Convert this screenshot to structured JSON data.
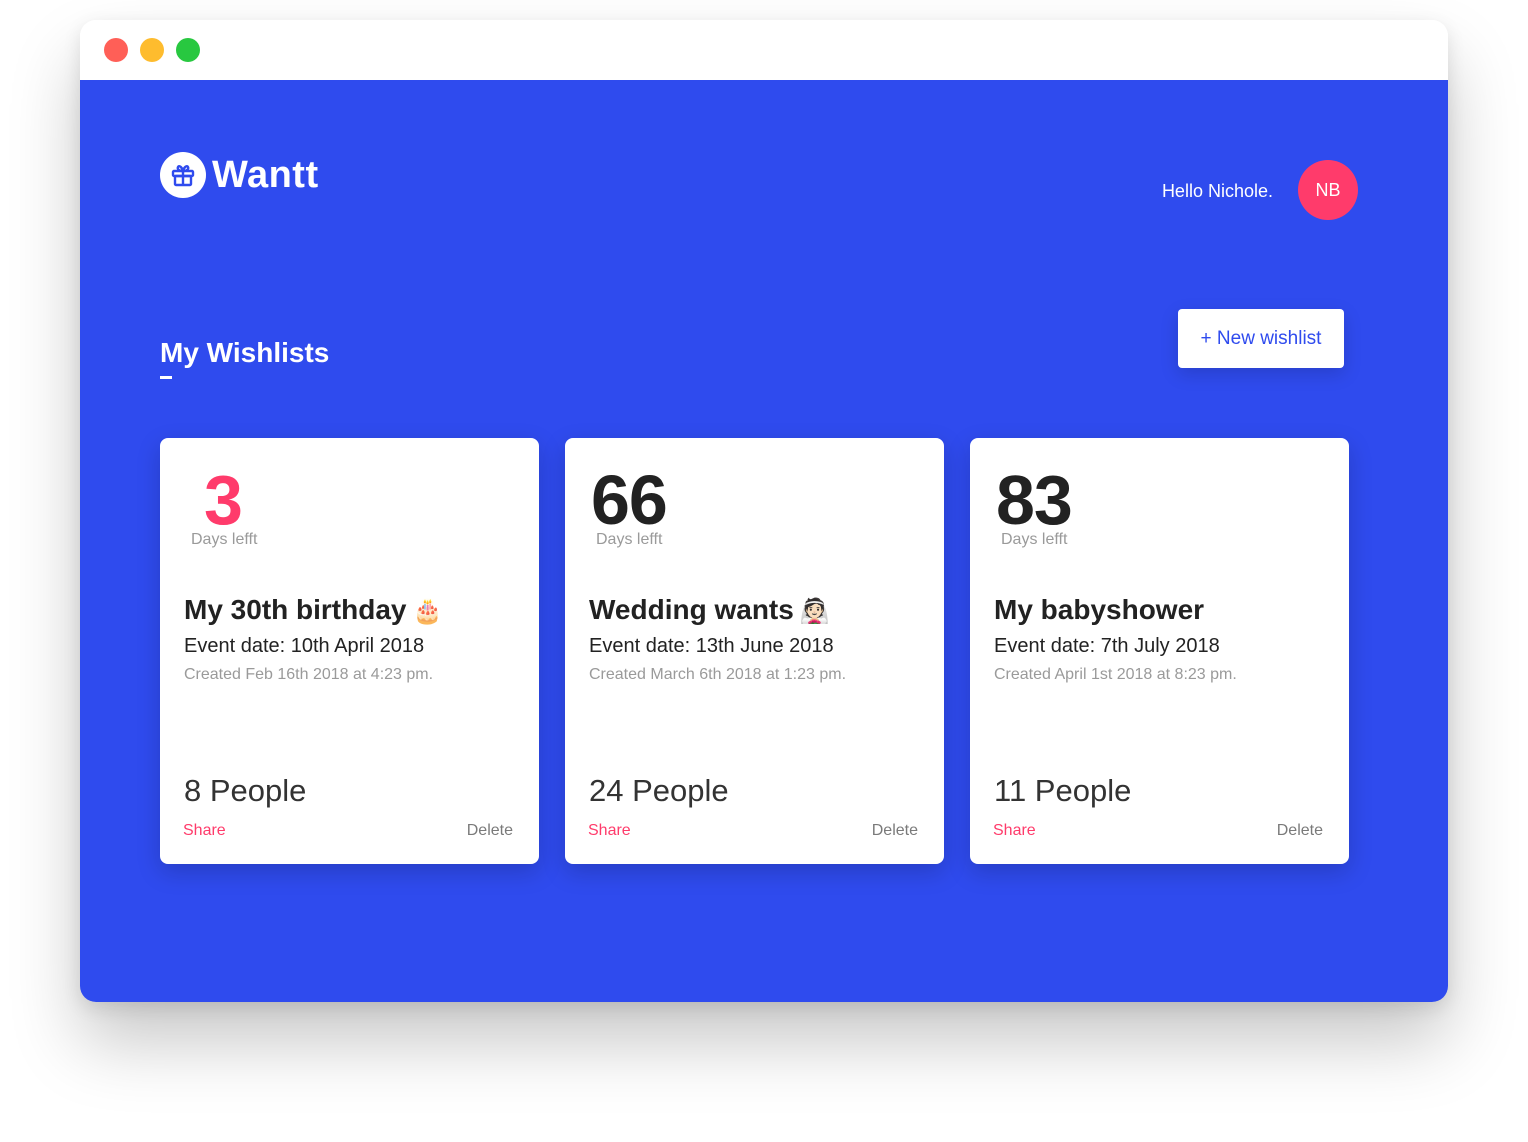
{
  "colors": {
    "primary_blue": "#2F4BEE",
    "accent_pink": "#FF3B6B",
    "dot_red": "#FF5F57",
    "dot_yellow": "#FEBC2E",
    "dot_green": "#28C840",
    "text_dark": "#222222",
    "text_muted": "#9A9A9A"
  },
  "window": {
    "controls": [
      "close-icon",
      "minimize-icon",
      "zoom-icon"
    ]
  },
  "header": {
    "logo_icon": "gift-icon",
    "logo_text": "Wantt",
    "greeting": "Hello Nichole.",
    "avatar_initials": "NB"
  },
  "main": {
    "section_title": "My Wishlists",
    "new_wishlist_label": "+ New wishlist",
    "cards": [
      {
        "days": "3",
        "days_label": "Days lefft",
        "title": "My 30th birthday",
        "emoji": "🎂",
        "event_date": "Event date: 10th April 2018",
        "created": "Created Feb 16th 2018 at 4:23 pm.",
        "people": "8 People",
        "share_label": "Share",
        "delete_label": "Delete"
      },
      {
        "days": "66",
        "days_label": "Days lefft",
        "title": "Wedding wants",
        "emoji": "👰🏻",
        "event_date": "Event date: 13th June 2018",
        "created": "Created March 6th 2018 at 1:23 pm.",
        "people": "24 People",
        "share_label": "Share",
        "delete_label": "Delete"
      },
      {
        "days": "83",
        "days_label": "Days lefft",
        "title": "My babyshower",
        "emoji": "",
        "event_date": "Event date: 7th July 2018",
        "created": "Created April 1st 2018 at 8:23 pm.",
        "people": "11 People",
        "share_label": "Share",
        "delete_label": "Delete"
      }
    ]
  }
}
